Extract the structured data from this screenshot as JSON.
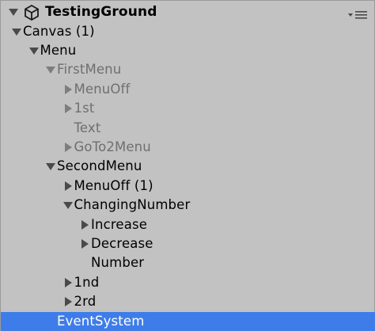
{
  "hierarchy": {
    "scene": {
      "name": "TestingGround",
      "icon": "unity-scene-icon",
      "menu_icon": "options-menu-icon"
    },
    "items": [
      {
        "label": "Canvas (1)",
        "depth": 1,
        "expander": "expanded",
        "active": true,
        "selected": false
      },
      {
        "label": "Menu",
        "depth": 2,
        "expander": "expanded",
        "active": true,
        "selected": false
      },
      {
        "label": "FirstMenu",
        "depth": 3,
        "expander": "expanded",
        "active": false,
        "selected": false
      },
      {
        "label": "MenuOff",
        "depth": 4,
        "expander": "collapsed",
        "active": false,
        "selected": false
      },
      {
        "label": "1st",
        "depth": 4,
        "expander": "collapsed",
        "active": false,
        "selected": false
      },
      {
        "label": "Text",
        "depth": 4,
        "expander": "none",
        "active": false,
        "selected": false
      },
      {
        "label": "GoTo2Menu",
        "depth": 4,
        "expander": "collapsed",
        "active": false,
        "selected": false
      },
      {
        "label": "SecondMenu",
        "depth": 3,
        "expander": "expanded",
        "active": true,
        "selected": false
      },
      {
        "label": "MenuOff (1)",
        "depth": 4,
        "expander": "collapsed",
        "active": true,
        "selected": false
      },
      {
        "label": "ChangingNumber",
        "depth": 4,
        "expander": "expanded",
        "active": true,
        "selected": false
      },
      {
        "label": "Increase",
        "depth": 5,
        "expander": "collapsed",
        "active": true,
        "selected": false
      },
      {
        "label": "Decrease",
        "depth": 5,
        "expander": "collapsed",
        "active": true,
        "selected": false
      },
      {
        "label": "Number",
        "depth": 5,
        "expander": "none",
        "active": true,
        "selected": false
      },
      {
        "label": "1nd",
        "depth": 4,
        "expander": "collapsed",
        "active": true,
        "selected": false
      },
      {
        "label": "2rd",
        "depth": 4,
        "expander": "collapsed",
        "active": true,
        "selected": false
      },
      {
        "label": "EventSystem",
        "depth": 3,
        "expander": "none",
        "active": true,
        "selected": true
      }
    ],
    "colors": {
      "panel_background": "#c2c2c2",
      "selection": "#3e7de9",
      "inactive_text": "#6f6f6f",
      "active_text": "#000000",
      "arrow_active": "#4a4a4a",
      "arrow_inactive": "#7d7d7d"
    }
  }
}
